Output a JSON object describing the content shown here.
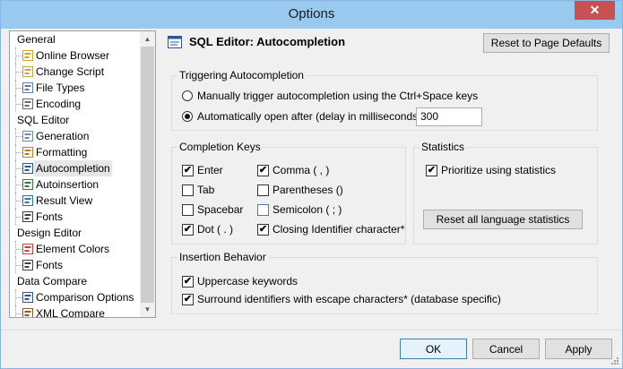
{
  "window": {
    "title": "Options",
    "close_glyph": "✕"
  },
  "tree": {
    "items": [
      {
        "kind": "group",
        "label": "General"
      },
      {
        "kind": "child",
        "label": "Online Browser",
        "icon": "online-browser-icon"
      },
      {
        "kind": "child",
        "label": "Change Script",
        "icon": "change-script-icon"
      },
      {
        "kind": "child",
        "label": "File Types",
        "icon": "file-types-icon"
      },
      {
        "kind": "child",
        "label": "Encoding",
        "icon": "encoding-icon"
      },
      {
        "kind": "group",
        "label": "SQL Editor"
      },
      {
        "kind": "child",
        "label": "Generation",
        "icon": "generation-icon"
      },
      {
        "kind": "child",
        "label": "Formatting",
        "icon": "formatting-icon"
      },
      {
        "kind": "child",
        "label": "Autocompletion",
        "icon": "autocompletion-icon",
        "selected": true
      },
      {
        "kind": "child",
        "label": "Autoinsertion",
        "icon": "autoinsertion-icon"
      },
      {
        "kind": "child",
        "label": "Result View",
        "icon": "result-view-icon"
      },
      {
        "kind": "child",
        "label": "Fonts",
        "icon": "fonts-icon"
      },
      {
        "kind": "group",
        "label": "Design Editor"
      },
      {
        "kind": "child",
        "label": "Element Colors",
        "icon": "element-colors-icon"
      },
      {
        "kind": "child",
        "label": "Fonts",
        "icon": "fonts-icon"
      },
      {
        "kind": "group",
        "label": "Data Compare"
      },
      {
        "kind": "child",
        "label": "Comparison Options",
        "icon": "comparison-options-icon"
      },
      {
        "kind": "child",
        "label": "XML Compare",
        "icon": "xml-compare-icon"
      }
    ]
  },
  "panel": {
    "title": "SQL Editor: Autocompletion",
    "reset_defaults_label": "Reset to Page Defaults"
  },
  "triggering": {
    "title": "Triggering Autocompletion",
    "manual_label": "Manually trigger autocompletion using the Ctrl+Space keys",
    "manual_selected": false,
    "auto_label": "Automatically open after (delay in milliseconds) :",
    "auto_selected": true,
    "delay_value": "300"
  },
  "completion_keys": {
    "title": "Completion Keys",
    "keys": [
      {
        "label": "Enter",
        "checked": true
      },
      {
        "label": "Comma ( , )",
        "checked": true
      },
      {
        "label": "Tab",
        "checked": false
      },
      {
        "label": "Parentheses ()",
        "checked": false
      },
      {
        "label": "Spacebar",
        "checked": false
      },
      {
        "label": "Semicolon ( ; )",
        "checked": false
      },
      {
        "label": "Dot ( . )",
        "checked": true
      },
      {
        "label": "Closing Identifier character*",
        "checked": true
      }
    ]
  },
  "statistics": {
    "title": "Statistics",
    "prioritize_label": "Prioritize using statistics",
    "prioritize_checked": true,
    "reset_label": "Reset all language statistics"
  },
  "insertion": {
    "title": "Insertion Behavior",
    "uppercase_label": "Uppercase keywords",
    "uppercase_checked": true,
    "surround_label": "Surround identifiers with escape characters* (database specific)",
    "surround_checked": true
  },
  "footer": {
    "ok_label": "OK",
    "cancel_label": "Cancel",
    "apply_label": "Apply"
  },
  "check_glyph": "✔"
}
